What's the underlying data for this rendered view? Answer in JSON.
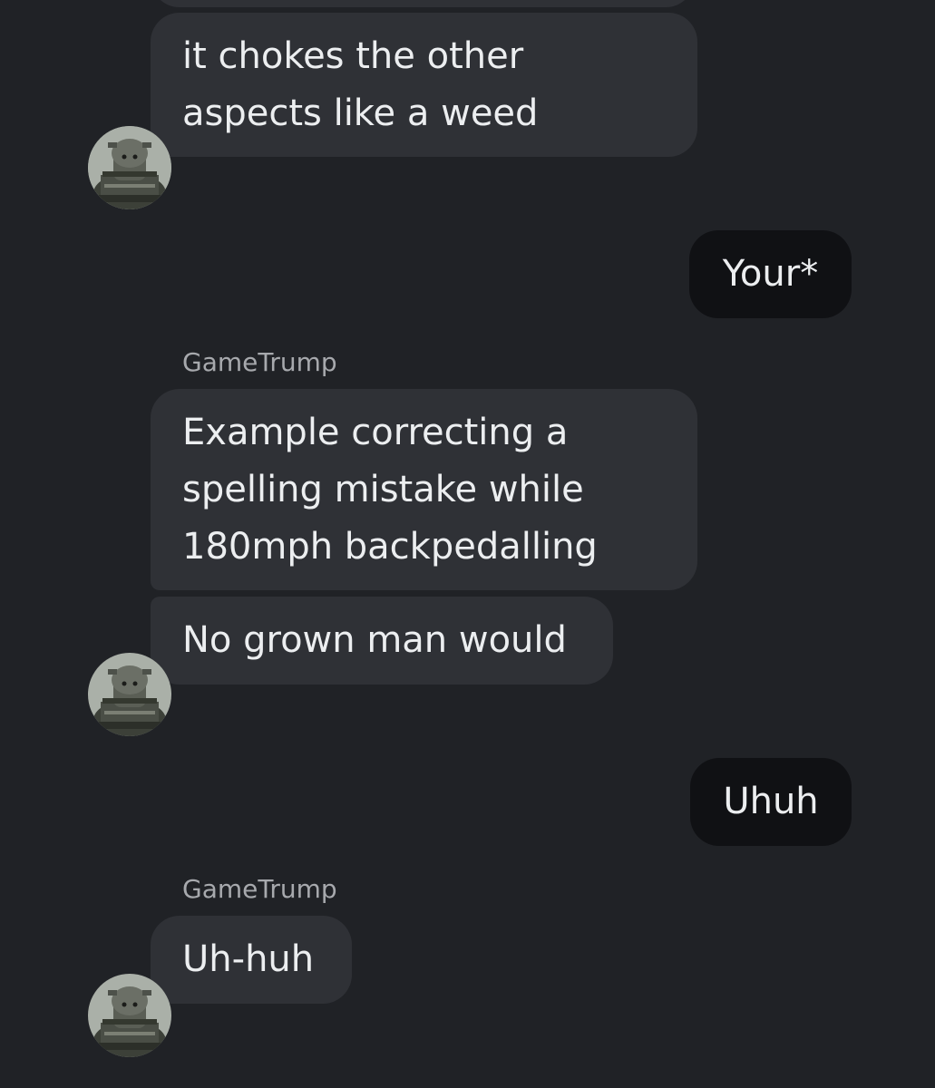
{
  "messages": [
    {
      "id": "m1",
      "direction": "incoming",
      "text_lines": [
        "it chokes the other",
        "aspects like a weed"
      ]
    },
    {
      "id": "m2",
      "direction": "outgoing",
      "text": "Your*"
    },
    {
      "id": "m3",
      "direction": "incoming",
      "sender": "GameTrump",
      "text_lines": [
        "Example correcting a",
        "spelling mistake while",
        "180mph backpedalling"
      ]
    },
    {
      "id": "m4",
      "direction": "incoming",
      "text": "No grown man would"
    },
    {
      "id": "m5",
      "direction": "outgoing",
      "text": "Uhuh"
    },
    {
      "id": "m6",
      "direction": "incoming",
      "sender": "GameTrump",
      "text": "Uh-huh"
    }
  ],
  "colors": {
    "background": "#202226",
    "incoming_bubble": "#2f3136",
    "outgoing_bubble": "#101114",
    "text": "#eceef0",
    "sender_name": "#a7a9ad"
  },
  "icons": {
    "avatar": "contact-avatar-image"
  }
}
